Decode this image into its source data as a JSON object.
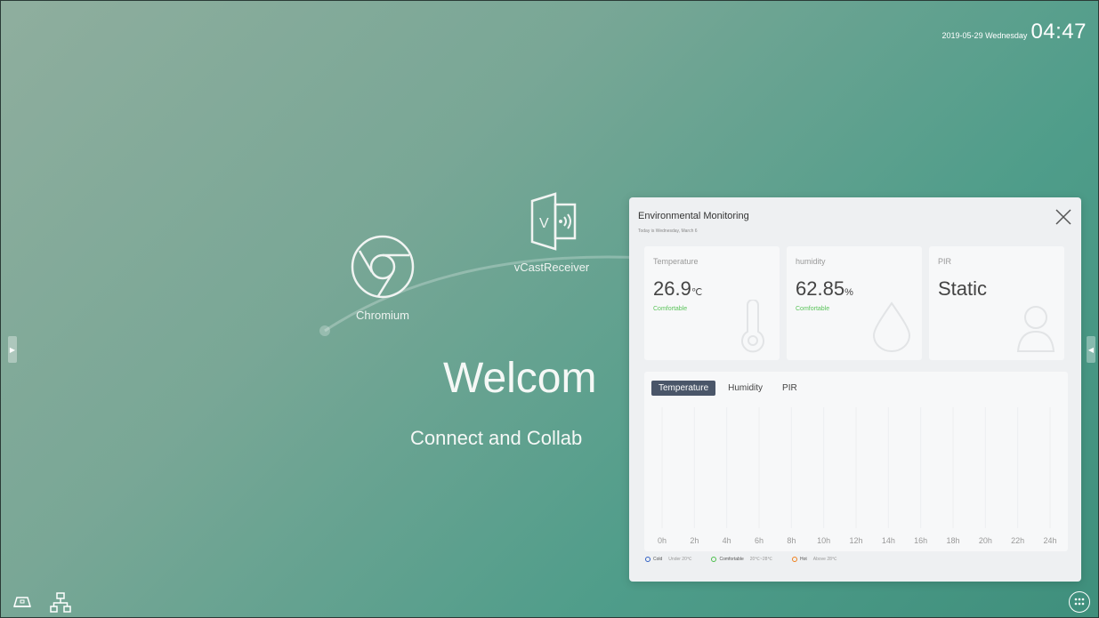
{
  "topbar": {
    "date": "2019-05-29 Wednesday",
    "time": "04:47"
  },
  "apps": [
    {
      "label": "Chromium",
      "icon": "chrome-icon"
    },
    {
      "label": "vCastReceiver",
      "icon": "vcast-icon"
    }
  ],
  "welcome": {
    "title": "Welcom",
    "subtitle": "Connect and Collab"
  },
  "panel": {
    "title": "Environmental Monitoring",
    "subtitle": "Today is Wednesday, March 6",
    "cards": [
      {
        "label": "Temperature",
        "value": "26.9",
        "unit": "℃",
        "status": "Comfortable"
      },
      {
        "label": "humidity",
        "value": "62.85",
        "unit": "%",
        "status": "Comfortable"
      },
      {
        "label": "PIR",
        "value": "Static"
      }
    ],
    "tabs": [
      "Temperature",
      "Humidity",
      "PIR"
    ],
    "legend": [
      {
        "label": "Cold",
        "note": "Under 20℃",
        "color": "#2f5fc4"
      },
      {
        "label": "Comfortable",
        "note": "20℃~28℃",
        "color": "#4bbf4b"
      },
      {
        "label": "Hot",
        "note": "Above 28℃",
        "color": "#ef7f1a"
      }
    ]
  },
  "chart_data": {
    "type": "line",
    "categories": [
      "0h",
      "2h",
      "4h",
      "6h",
      "8h",
      "10h",
      "12h",
      "14h",
      "16h",
      "18h",
      "20h",
      "22h",
      "24h"
    ],
    "series": []
  }
}
